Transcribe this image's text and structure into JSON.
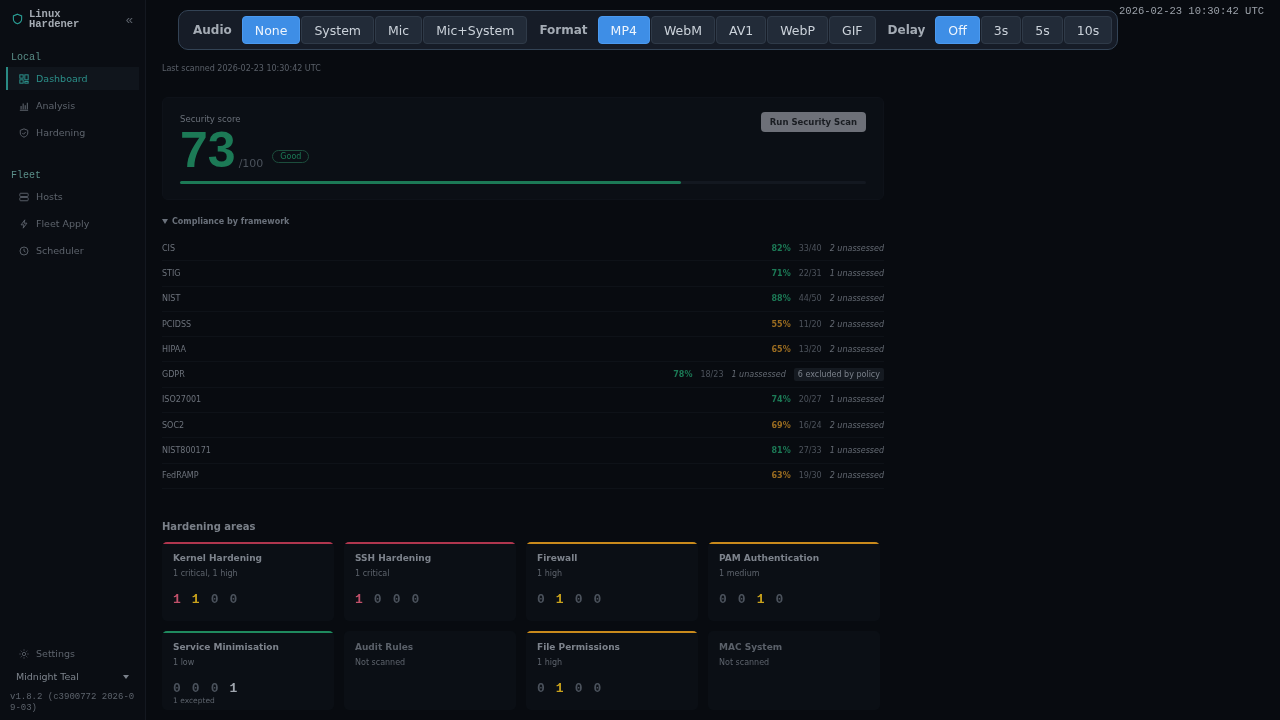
{
  "sidebar": {
    "brand": "Linux\nHardener",
    "collapse": "«",
    "sections": [
      {
        "title": "Local",
        "items": [
          {
            "label": "Dashboard",
            "selected": true
          },
          {
            "label": "Analysis",
            "selected": false
          },
          {
            "label": "Hardening",
            "selected": false
          }
        ]
      },
      {
        "title": "Fleet",
        "items": [
          {
            "label": "Hosts",
            "selected": false
          },
          {
            "label": "Fleet Apply",
            "selected": false
          },
          {
            "label": "Scheduler",
            "selected": false
          }
        ]
      }
    ],
    "settings": "Settings",
    "theme": "Midnight Teal",
    "version": "v1.8.2 (c3900772 2026-09-03)"
  },
  "status_bar": {
    "right_value": "2026-02-23 10:30:42 UTC"
  },
  "recorder": {
    "groups": [
      {
        "label": "Audio",
        "options": [
          {
            "label": "None",
            "selected": true
          },
          {
            "label": "System",
            "selected": false
          },
          {
            "label": "Mic",
            "selected": false
          },
          {
            "label": "Mic+System",
            "selected": false
          }
        ]
      },
      {
        "label": "Format",
        "options": [
          {
            "label": "MP4",
            "selected": true
          },
          {
            "label": "WebM",
            "selected": false
          },
          {
            "label": "AV1",
            "selected": false
          },
          {
            "label": "WebP",
            "selected": false
          },
          {
            "label": "GIF",
            "selected": false
          }
        ]
      },
      {
        "label": "Delay",
        "options": [
          {
            "label": "Off",
            "selected": true
          },
          {
            "label": "3s",
            "selected": false
          },
          {
            "label": "5s",
            "selected": false
          },
          {
            "label": "10s",
            "selected": false
          }
        ]
      }
    ]
  },
  "page": {
    "subtitle": "Last scanned 2026-02-23 10:30:42 UTC"
  },
  "score": {
    "label": "Security score",
    "value": "73",
    "max": "/100",
    "badge": "Good",
    "level": 0.73,
    "button": "Run Security Scan"
  },
  "compliance": {
    "title": "Compliance by framework",
    "expanded": true,
    "rows": [
      {
        "name": "CIS",
        "pct": "82%",
        "color": "#1c7a56",
        "ratio": "33/40",
        "unassessed": "2 unassessed"
      },
      {
        "name": "STIG",
        "pct": "71%",
        "color": "#1c7a56",
        "ratio": "22/31",
        "unassessed": "1 unassessed"
      },
      {
        "name": "NIST",
        "pct": "88%",
        "color": "#1c7a56",
        "ratio": "44/50",
        "unassessed": "2 unassessed"
      },
      {
        "name": "PCIDSS",
        "pct": "55%",
        "color": "#9a6c20",
        "ratio": "11/20",
        "unassessed": "2 unassessed"
      },
      {
        "name": "HIPAA",
        "pct": "65%",
        "color": "#9a6c20",
        "ratio": "13/20",
        "unassessed": "2 unassessed"
      },
      {
        "name": "GDPR",
        "pct": "78%",
        "color": "#1c7a56",
        "ratio": "18/23",
        "unassessed": "1 unassessed",
        "note": "6 excluded by policy"
      },
      {
        "name": "ISO27001",
        "pct": "74%",
        "color": "#1c7a56",
        "ratio": "20/27",
        "unassessed": "1 unassessed"
      },
      {
        "name": "SOC2",
        "pct": "69%",
        "color": "#9a6c20",
        "ratio": "16/24",
        "unassessed": "2 unassessed"
      },
      {
        "name": "NIST800171",
        "pct": "81%",
        "color": "#1c7a56",
        "ratio": "27/33",
        "unassessed": "1 unassessed"
      },
      {
        "name": "FedRAMP",
        "pct": "63%",
        "color": "#9a6c20",
        "ratio": "19/30",
        "unassessed": "2 unassessed"
      }
    ]
  },
  "areas": {
    "title": "Hardening areas",
    "cards": [
      {
        "title": "Kernel Hardening",
        "summary": "1 critical, 1 high",
        "color": "#b0364e",
        "scanned": true,
        "counts": [
          "1",
          "1",
          "0",
          "0"
        ]
      },
      {
        "title": "SSH Hardening",
        "summary": "1 critical",
        "color": "#b0364e",
        "scanned": true,
        "counts": [
          "1",
          "0",
          "0",
          "0"
        ]
      },
      {
        "title": "Firewall",
        "summary": "1 high",
        "color": "#c98a1c",
        "scanned": true,
        "counts": [
          "0",
          "1",
          "0",
          "0"
        ]
      },
      {
        "title": "PAM Authentication",
        "summary": "1 medium",
        "color": "#c98a1c",
        "scanned": true,
        "counts": [
          "0",
          "0",
          "1",
          "0"
        ]
      },
      {
        "title": "Service Minimisation",
        "summary": "1 low",
        "color": "#1f8a5e",
        "scanned": true,
        "counts": [
          "0",
          "0",
          "0",
          "1"
        ],
        "excepted": "1 excepted"
      },
      {
        "title": "Audit Rules",
        "summary": "Not scanned",
        "scanned": false
      },
      {
        "title": "File Permissions",
        "summary": "1 high",
        "color": "#c98a1c",
        "scanned": true,
        "counts": [
          "0",
          "1",
          "0",
          "0"
        ]
      },
      {
        "title": "MAC System",
        "summary": "Not scanned",
        "scanned": false
      }
    ]
  }
}
